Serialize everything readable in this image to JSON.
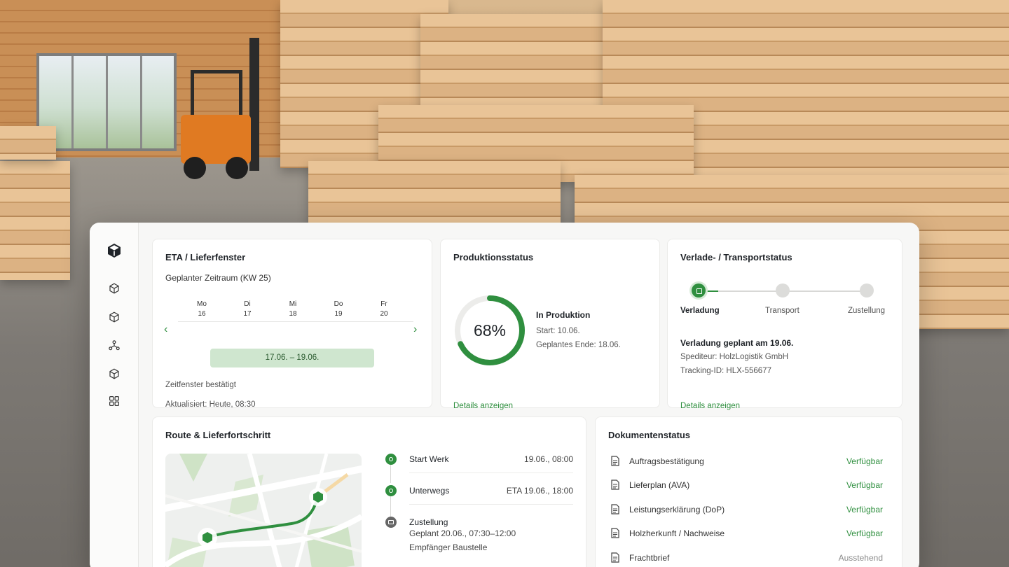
{
  "eta": {
    "title": "ETA / Lieferfenster",
    "subtitle": "Geplanter Zeitraum (KW 25)",
    "days": [
      {
        "name": "Mo",
        "num": "16"
      },
      {
        "name": "Di",
        "num": "17"
      },
      {
        "name": "Mi",
        "num": "18"
      },
      {
        "name": "Do",
        "num": "19"
      },
      {
        "name": "Fr",
        "num": "20"
      }
    ],
    "window": "17.06. – 19.06.",
    "confirmed": "Zeitfenster bestätigt",
    "updated": "Aktualisiert: Heute, 08:30"
  },
  "production": {
    "title": "Produktionsstatus",
    "percent_label": "68%",
    "progress": 0.68,
    "state": "In Produktion",
    "start": "Start: 10.06.",
    "end": "Geplantes Ende: 18.06.",
    "details": "Details anzeigen"
  },
  "transport": {
    "title": "Verlade- / Transportstatus",
    "steps": [
      "Verladung",
      "Transport",
      "Zustellung"
    ],
    "active_step": 0,
    "line1": "Verladung geplant am 19.06.",
    "line2": "Spediteur: HolzLogistik GmbH",
    "line3": "Tracking-ID: HLX-556677",
    "details": "Details anzeigen"
  },
  "route": {
    "title": "Route & Lieferfortschritt",
    "timeline": [
      {
        "label": "Start Werk",
        "time": "19.06., 08:00"
      },
      {
        "label": "Unterwegs",
        "time": "ETA 19.06., 18:00"
      },
      {
        "label": "Zustellung",
        "sub1": "Geplant 20.06., 07:30–12:00",
        "sub2": "Empfänger Baustelle"
      }
    ]
  },
  "documents": {
    "title": "Dokumentenstatus",
    "items": [
      {
        "name": "Auftragsbestätigung",
        "status": "Verfügbar"
      },
      {
        "name": "Lieferplan (AVA)",
        "status": "Verfügbar"
      },
      {
        "name": "Leistungserklärung (DoP)",
        "status": "Verfügbar"
      },
      {
        "name": "Holzherkunft / Nachweise",
        "status": "Verfügbar"
      },
      {
        "name": "Frachtbrief",
        "status": "Ausstehend"
      }
    ]
  },
  "colors": {
    "accent": "#2f8f3f",
    "accent_light": "#cfe6cf",
    "muted": "#8a8a8a"
  },
  "icons": {
    "logo": "cube-icon",
    "nav": [
      "cube-icon",
      "cube-icon",
      "network-icon",
      "cube-icon",
      "grid-icon"
    ]
  }
}
